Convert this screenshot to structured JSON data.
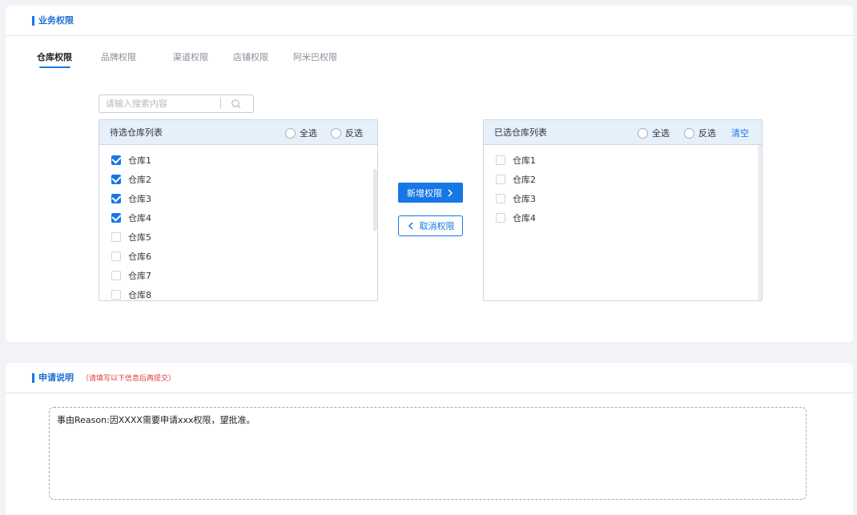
{
  "business": {
    "title": "业务权限",
    "tabs": [
      {
        "label": "仓库权限",
        "active": true
      },
      {
        "label": "品牌权限",
        "active": false
      },
      {
        "label": "渠道权限",
        "active": false
      },
      {
        "label": "店铺权限",
        "active": false
      },
      {
        "label": "阿米巴权限",
        "active": false
      }
    ],
    "search": {
      "placeholder": "请输入搜索内容",
      "value": "",
      "icon": "search-icon"
    },
    "left_panel": {
      "title": "待选仓库列表",
      "select_all": "全选",
      "invert": "反选",
      "items": [
        {
          "label": "仓库1",
          "checked": true
        },
        {
          "label": "仓库2",
          "checked": true
        },
        {
          "label": "仓库3",
          "checked": true
        },
        {
          "label": "仓库4",
          "checked": true
        },
        {
          "label": "仓库5",
          "checked": false
        },
        {
          "label": "仓库6",
          "checked": false
        },
        {
          "label": "仓库7",
          "checked": false
        },
        {
          "label": "仓库8",
          "checked": false
        }
      ]
    },
    "add_button": "新增权限",
    "remove_button": "取消权限",
    "right_panel": {
      "title": "已选仓库列表",
      "select_all": "全选",
      "invert": "反选",
      "clear": "清空",
      "items": [
        {
          "label": "仓库1",
          "checked": false
        },
        {
          "label": "仓库2",
          "checked": false
        },
        {
          "label": "仓库3",
          "checked": false
        },
        {
          "label": "仓库4",
          "checked": false
        }
      ]
    }
  },
  "apply": {
    "title": "申请说明",
    "hint": "（请填写以下信息后再提交）",
    "reason": "事由Reason:因XXXX需要申请xxx权限，望批准。"
  },
  "colors": {
    "accent": "#1677e6",
    "hint": "#e03a3a",
    "panel_head": "#e6f0fb"
  }
}
